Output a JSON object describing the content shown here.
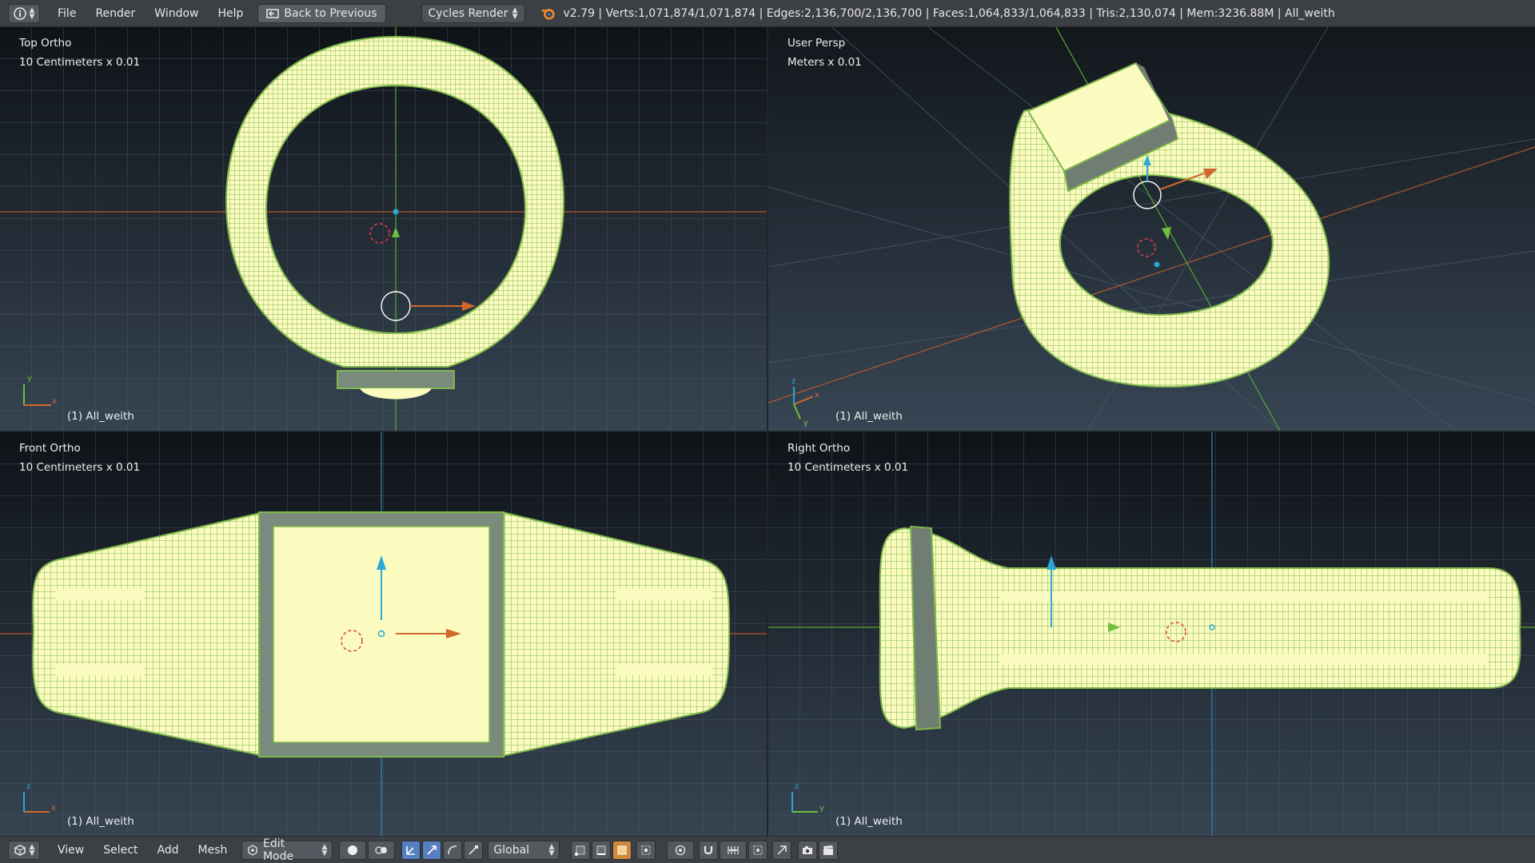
{
  "topbar": {
    "menu": [
      "File",
      "Render",
      "Window",
      "Help"
    ],
    "back_label": "Back to Previous",
    "engine": "Cycles Render",
    "stats": "v2.79 | Verts:1,071,874/1,071,874 | Edges:2,136,700/2,136,700 | Faces:1,064,833/1,064,833 | Tris:2,130,074 | Mem:3236.88M | All_weith"
  },
  "viewports": {
    "top": {
      "label": "Top Ortho",
      "scale": "10 Centimeters x 0.01",
      "object": "(1) All_weith",
      "axis_a": "y",
      "axis_b": "x"
    },
    "persp": {
      "label": "User Persp",
      "scale": "Meters x 0.01",
      "object": "(1) All_weith",
      "axis_a": "z",
      "axis_b": "x",
      "axis_c": "y"
    },
    "front": {
      "label": "Front Ortho",
      "scale": "10 Centimeters x 0.01",
      "object": "(1) All_weith",
      "axis_a": "z",
      "axis_b": "x"
    },
    "right": {
      "label": "Right Ortho",
      "scale": "10 Centimeters x 0.01",
      "object": "(1) All_weith",
      "axis_a": "z",
      "axis_b": "y"
    }
  },
  "bottombar": {
    "menu": [
      "View",
      "Select",
      "Add",
      "Mesh"
    ],
    "mode": "Edit Mode",
    "orientation": "Global"
  },
  "colors": {
    "mesh_fill": "#fbfbc0",
    "mesh_wire": "#7fb84a",
    "x_axis": "#d2672d",
    "y_axis": "#6fbf3f",
    "z_axis": "#2aa8d8",
    "header_bg": "#3c3f44"
  }
}
